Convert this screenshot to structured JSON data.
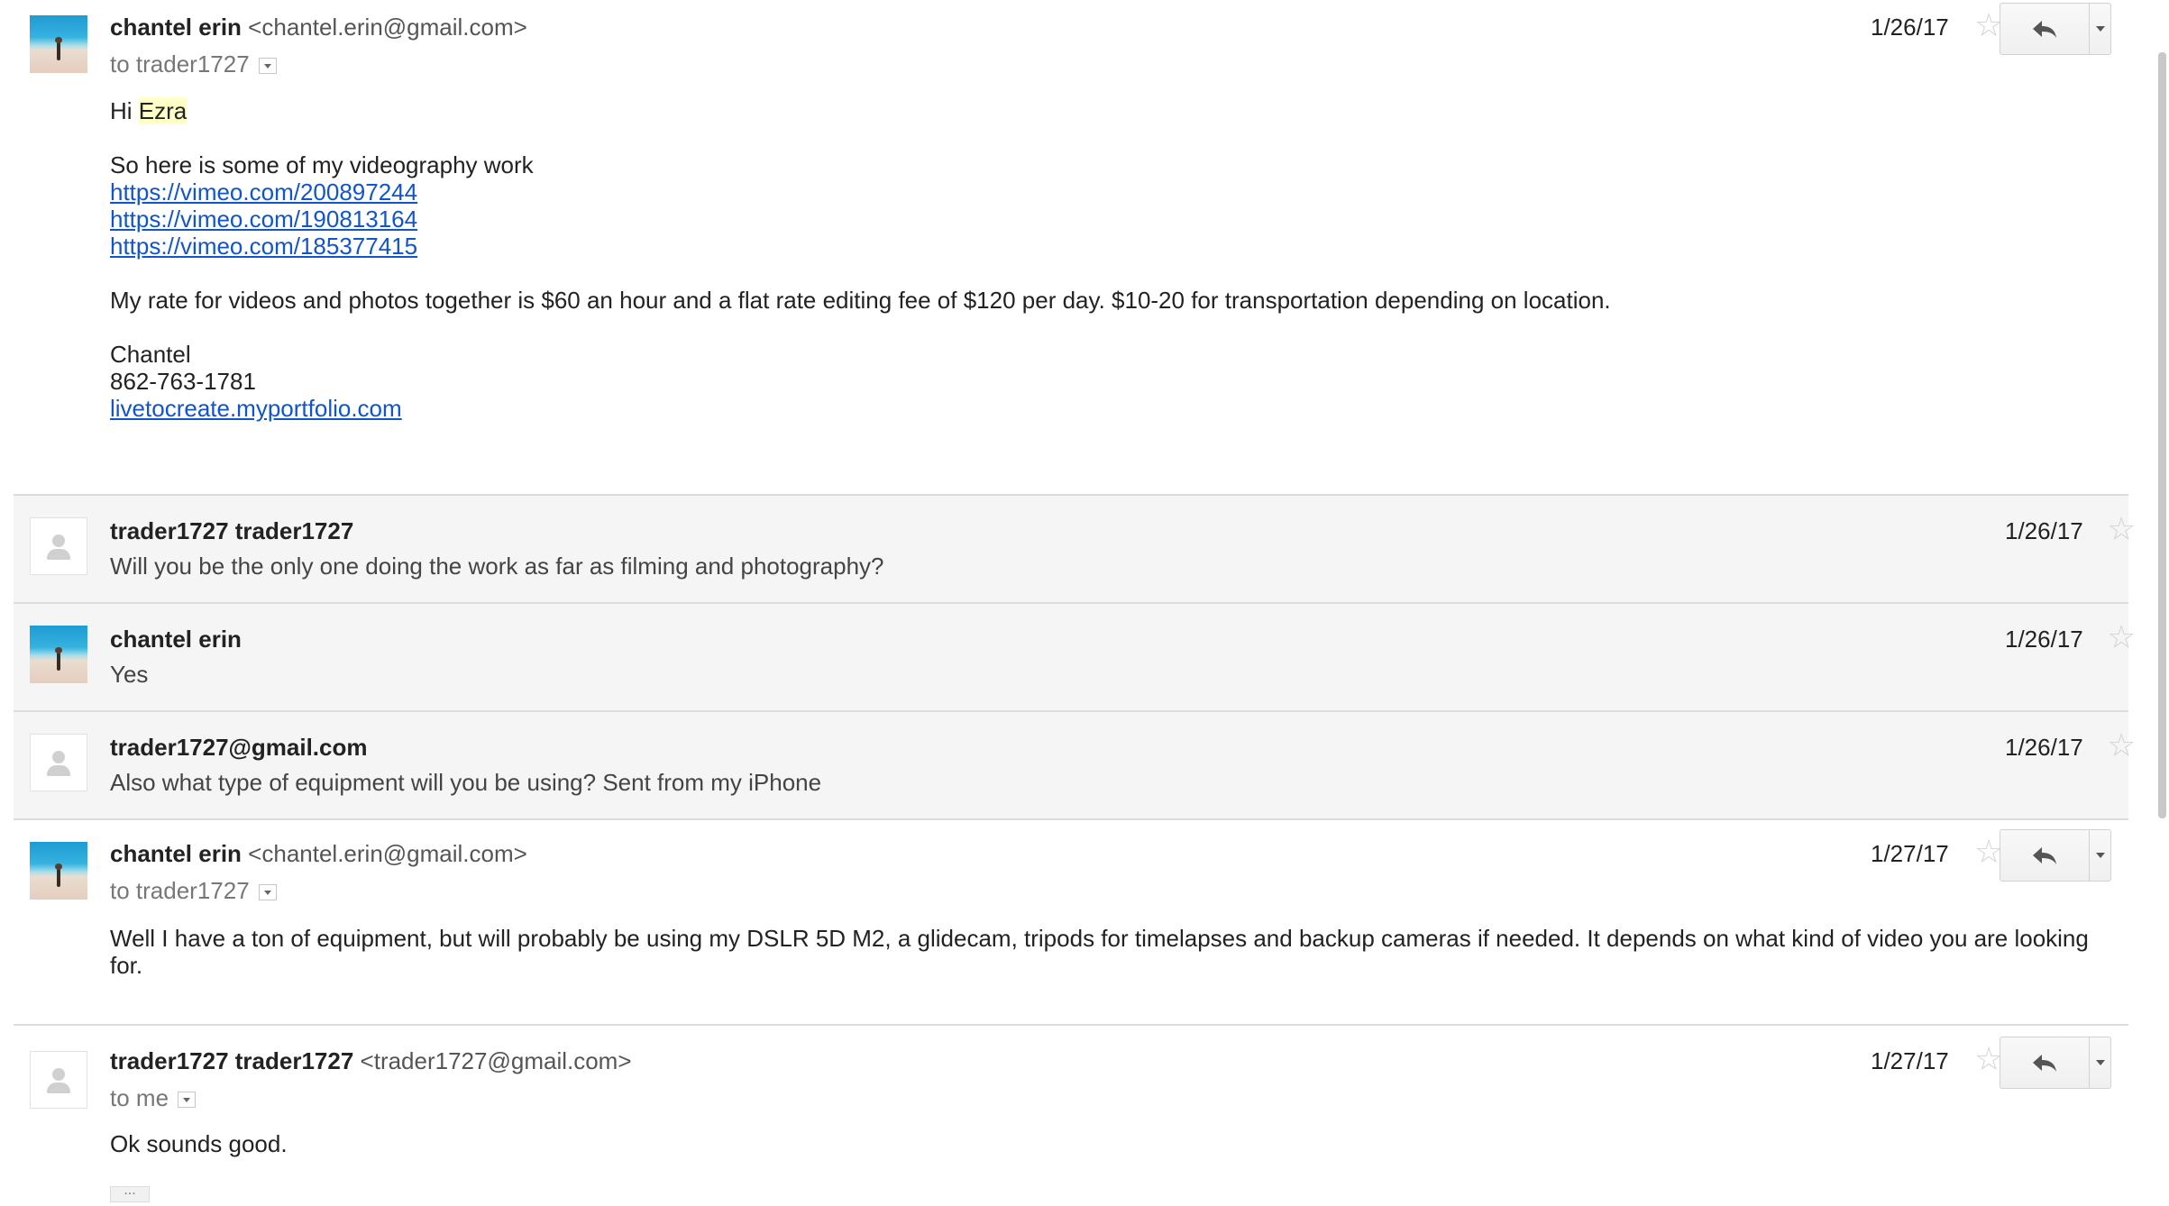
{
  "messages": [
    {
      "sender_name": "chantel erin",
      "sender_email": "<chantel.erin@gmail.com>",
      "to": "to trader1727",
      "date": "1/26/17",
      "greeting": "Hi",
      "greeting_name": "Ezra",
      "intro": "So here is some of my videography work",
      "links": [
        "https://vimeo.com/200897244",
        "https://vimeo.com/190813164",
        "https://vimeo.com/185377415"
      ],
      "rate": "My rate for videos and photos together is $60 an hour and a flat rate editing fee of $120 per day. $10-20 for transportation depending on location.",
      "sig_name": "Chantel",
      "sig_phone": "862-763-1781",
      "sig_link": "livetocreate.myportfolio.com"
    },
    {
      "sender_name": "trader1727 trader1727",
      "date": "1/26/17",
      "snippet": "Will you be the only one doing the work as far as filming and photography?"
    },
    {
      "sender_name": "chantel erin",
      "date": "1/26/17",
      "snippet": "Yes"
    },
    {
      "sender_name": "trader1727@gmail.com",
      "date": "1/26/17",
      "snippet": "Also what type of equipment will you be using? Sent from my iPhone"
    },
    {
      "sender_name": "chantel erin",
      "sender_email": "<chantel.erin@gmail.com>",
      "to": "to trader1727",
      "date": "1/27/17",
      "body_line1": "Well I have a ton of equipment, but will probably be using my DSLR 5D M2, a glidecam, tripods for timelapses and backup cameras if needed. It depends on what kind of video you are looking",
      "body_line2": "for."
    },
    {
      "sender_name": "trader1727 trader1727",
      "sender_email": "<trader1727@gmail.com>",
      "to": "to me",
      "date": "1/27/17",
      "body": "Ok sounds good.",
      "trimmed": "..."
    }
  ],
  "icons": {
    "star": "☆",
    "reply": "reply-arrow",
    "more": "chevron-down"
  },
  "colors": {
    "link": "#1155cc",
    "highlight": "#ffffc8",
    "collapsed_bg": "#f5f5f5"
  }
}
